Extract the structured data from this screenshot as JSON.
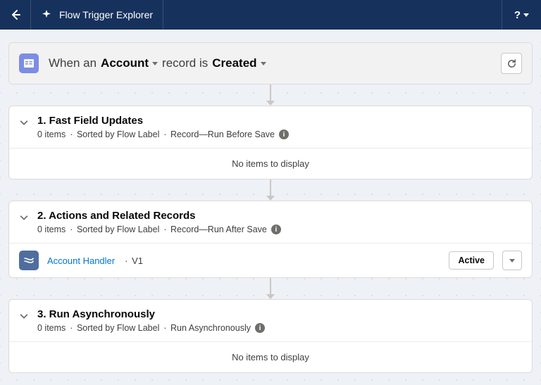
{
  "header": {
    "title": "Flow Trigger Explorer"
  },
  "filter": {
    "prefix": "When an",
    "object": "Account",
    "middle": "record is",
    "trigger": "Created"
  },
  "sections": [
    {
      "title": "1. Fast Field Updates",
      "items_count": "0 items",
      "sort": "Sorted by Flow Label",
      "type": "Record—Run Before Save",
      "empty": "No items to display"
    },
    {
      "title": "2. Actions and Related Records",
      "items_count": "0 items",
      "sort": "Sorted by Flow Label",
      "type": "Record—Run After Save",
      "flow": {
        "name": "Account Handler",
        "version": "V1",
        "status": "Active"
      }
    },
    {
      "title": "3. Run Asynchronously",
      "items_count": "0 items",
      "sort": "Sorted by Flow Label",
      "type": "Run Asynchronously",
      "empty": "No items to display"
    }
  ]
}
